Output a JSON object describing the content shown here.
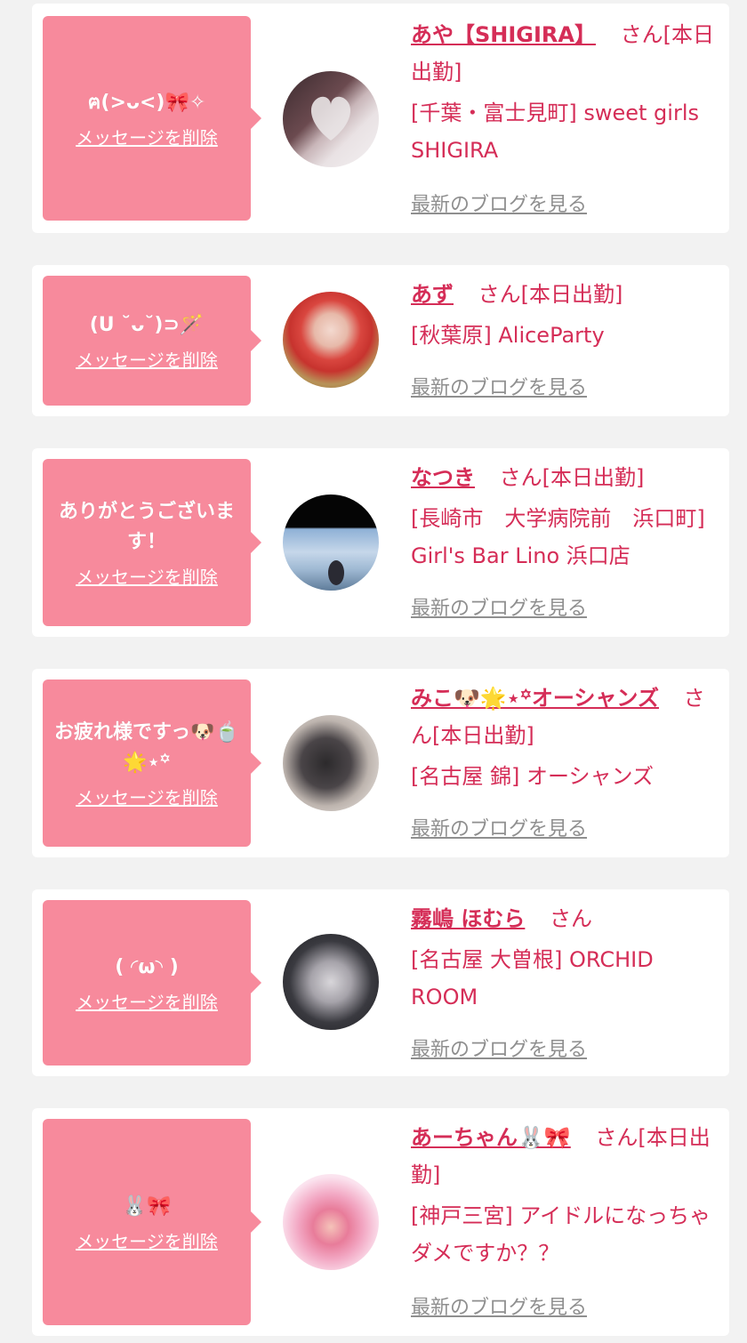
{
  "common": {
    "delete_label": "メッセージを削除",
    "blog_label": "最新のブログを見る",
    "san": "さん"
  },
  "cards": [
    {
      "message": "ฅ(>ᴗ<)🎀✧",
      "name": "あや【SHIGIRA】",
      "status": "[本日出勤]",
      "shop": "[千葉・富士見町] sweet girls SHIGIRA"
    },
    {
      "message": "(U ˘ᴗ˘)⊃🪄",
      "name": "あず",
      "status": "[本日出勤]",
      "shop": "[秋葉原] AliceParty"
    },
    {
      "message": "ありがとうございます！",
      "name": "なつき",
      "status": "[本日出勤]",
      "shop": "[長崎市　大学病院前　浜口町] Girl's Bar Lino 浜口店"
    },
    {
      "message": "お疲れ様ですっ🐶🍵🌟⋆꙳",
      "name": "みこ🐶🌟⋆꙳オーシャンズ",
      "status": "[本日出勤]",
      "shop": "[名古屋 錦] オーシャンズ"
    },
    {
      "message": "( ◜ω◝ )",
      "name": "霧嶋 ほむら",
      "status": "",
      "shop": "[名古屋 大曽根] ORCHID ROOM"
    },
    {
      "message": "🐰🎀",
      "name": "あーちゃん🐰🎀",
      "status": "[本日出勤]",
      "shop": "[神戸三宮] アイドルになっちゃダメですか？？"
    }
  ],
  "colors": {
    "accent": "#d52d57",
    "bubble": "#f78a9c",
    "muted": "#8f8f8f"
  }
}
